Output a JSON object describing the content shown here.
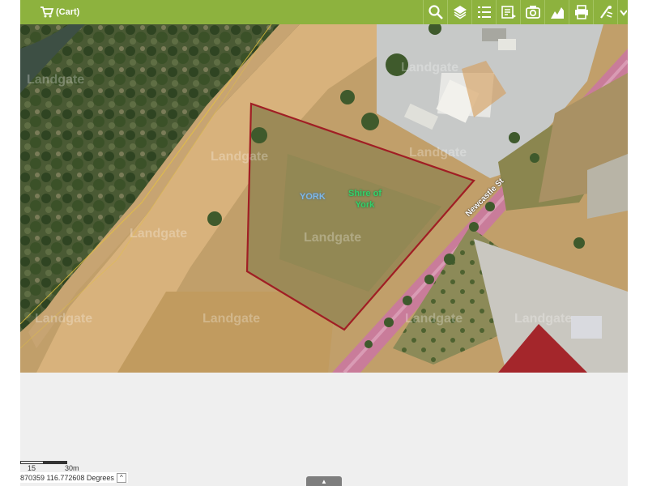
{
  "toolbar": {
    "cart_label": "(Cart)",
    "accent_color": "#8db23e",
    "buttons": [
      {
        "name": "search-button",
        "icon": "magnifier-icon"
      },
      {
        "name": "layers-button",
        "icon": "layers-icon"
      },
      {
        "name": "legend-button",
        "icon": "list-icon"
      },
      {
        "name": "report-button",
        "icon": "report-icon"
      },
      {
        "name": "photo-button",
        "icon": "camera-icon"
      },
      {
        "name": "elevation-button",
        "icon": "elevation-icon"
      },
      {
        "name": "print-button",
        "icon": "printer-icon"
      },
      {
        "name": "measure-button",
        "icon": "measure-icon"
      }
    ]
  },
  "map": {
    "labels": {
      "locality": "YORK",
      "council_line1": "Shire of",
      "council_line2": "York",
      "street": "Newcastle St"
    },
    "watermark": "Landgate",
    "boundary_color": "#a01e24"
  },
  "scale": {
    "label_a": "15",
    "label_b": "30m"
  },
  "coordinates": {
    "text": "870359 116.772608 Degrees",
    "toggle_symbol": "^"
  },
  "panel_toggle_symbol": "▲"
}
